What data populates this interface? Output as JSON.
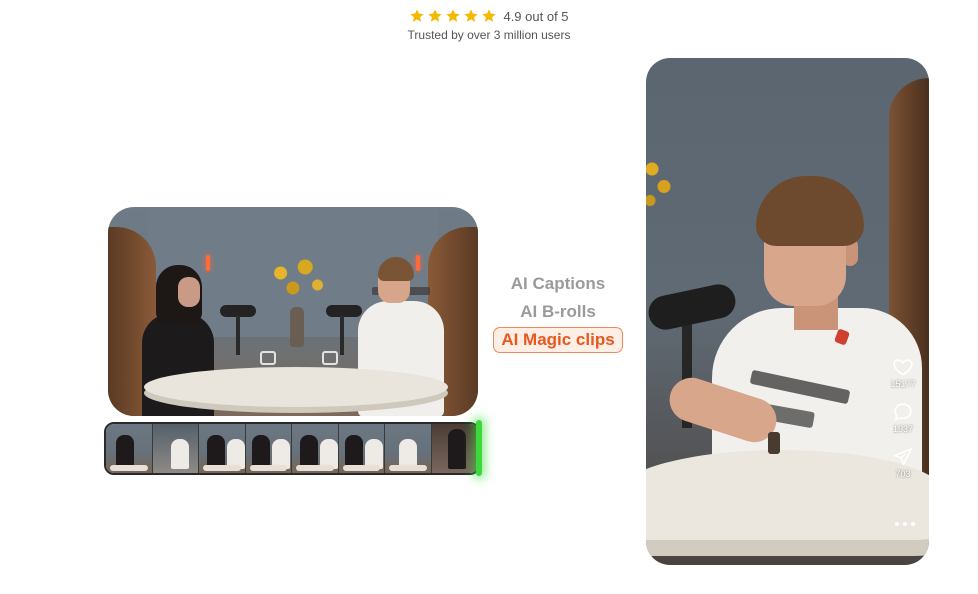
{
  "rating": {
    "star_count": 5,
    "star_color": "#f5b800",
    "score_text": "4.9 out of 5",
    "trusted_text": "Trusted by over 3 million users"
  },
  "features": {
    "items": [
      {
        "label": "AI Captions",
        "active": false
      },
      {
        "label": "AI B-rolls",
        "active": false
      },
      {
        "label": "AI Magic clips",
        "active": true
      }
    ],
    "active_color": "#e8581e"
  },
  "timeline": {
    "playhead_color": "#3cd83c"
  },
  "vertical_video": {
    "likes": "15177",
    "comments": "1937",
    "shares": "703",
    "icons": [
      "heart-icon",
      "comment-icon",
      "share-icon",
      "more-icon"
    ]
  }
}
